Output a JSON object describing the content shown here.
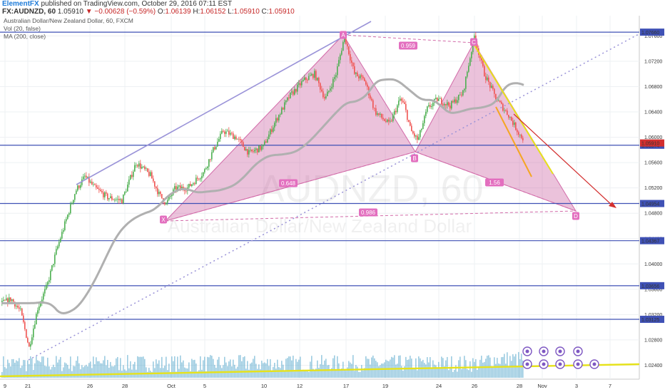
{
  "header": {
    "author": "ElementFX",
    "published": "published on TradingView.com, October 29, 2016 07:11 EST",
    "symbol": "FX:AUDNZD, 60",
    "last": "1.05910",
    "change": "−0.00628 (−0.59%)",
    "o_label": "O:",
    "o": "1.06139",
    "h_label": "H:",
    "h": "1.06152",
    "l_label": "L:",
    "l": "1.05910",
    "c_label": "C:",
    "c": "1.05910"
  },
  "legend": {
    "title": "Australian Dollar/New Zealand Dollar, 60, FXCM",
    "vol": "Vol (20, false)",
    "ma": "MA (200, close)"
  },
  "watermark": {
    "symbol": "AUDNZD, 60",
    "name": "Australian Dollar/New Zealand Dollar"
  },
  "colors": {
    "pattern_fill": "#c2408f",
    "pattern_stroke": "#d26aa8",
    "pattern_label_bg": "#e36fbf",
    "level_line": "#3f51b5",
    "level_label_bg": "#3f51b5",
    "trend_line": "#9a93d8",
    "ma_line": "#b0b0b0",
    "candle_up": "#4caf50",
    "candle_down": "#ef5350",
    "volume": "#4aa3c9",
    "yellow_line": "#e6e21a",
    "orange_line": "#f5a623",
    "red_arrow": "#d32f2f",
    "price_label_red": "#d32f2f"
  },
  "chart_data": {
    "type": "candlestick",
    "price_axis": {
      "ylim": [
        1.0218,
        1.0792
      ],
      "ticks": [
        "1.07600",
        "1.07200",
        "1.06800",
        "1.06400",
        "1.06000",
        "1.05600",
        "1.05200",
        "1.04800",
        "1.04400",
        "1.04000",
        "1.03600",
        "1.03200",
        "1.02800",
        "1.02400"
      ]
    },
    "time_axis": {
      "ticks": [
        "9",
        "21",
        "26",
        "28",
        "Oct",
        "5",
        "10",
        "12",
        "17",
        "19",
        "24",
        "26",
        "28",
        "Nov",
        "3",
        "7"
      ]
    },
    "horizontal_levels": [
      "1.07660",
      "1.05874",
      "1.04954",
      "1.04367",
      "1.03656",
      "1.03125"
    ],
    "last_price_label": "1.05910",
    "harmonic_pattern": {
      "points": [
        {
          "name": "X",
          "price": 1.0493
        },
        {
          "name": "A",
          "price": 1.0766
        },
        {
          "name": "B",
          "price": 1.0593
        },
        {
          "name": "C",
          "price": 1.0766
        },
        {
          "name": "D",
          "price": 1.05
        }
      ],
      "ratios": [
        "0.959",
        "0.648",
        "1.56",
        "0.986"
      ]
    },
    "grid": true,
    "legend_position": "top-left"
  },
  "icons": [
    "event-icon"
  ]
}
